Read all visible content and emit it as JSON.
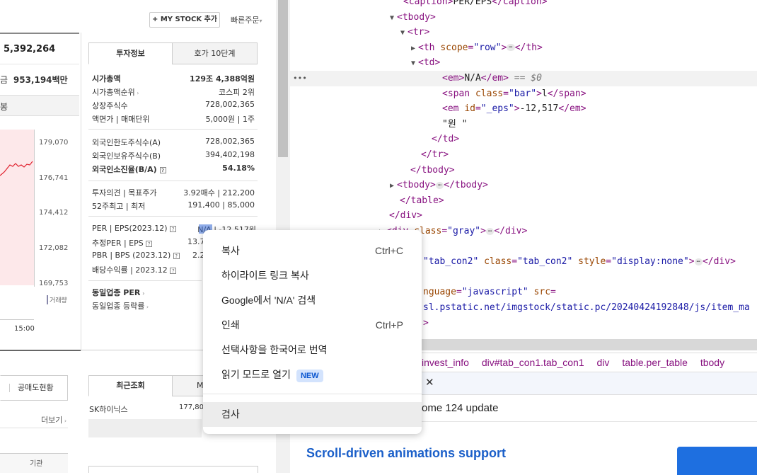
{
  "stock": {
    "mystock_button": "+ MY STOCK 추가",
    "quick_order": "빠른주문",
    "price_value": "5,392,264",
    "amount_label": "금",
    "amount_value": "953,194",
    "amount_unit": "백만",
    "chart_type_label": "봉",
    "y_labels": [
      "179,070",
      "176,741",
      "174,412",
      "172,082",
      "169,753"
    ],
    "time_label": "15:00",
    "volume_label": "거래량",
    "tabs": [
      "투자정보",
      "호가 10단계"
    ],
    "info_rows": [
      {
        "label": "시가총액",
        "value": "129조 4,388억원",
        "bold": true
      },
      {
        "label": "시가총액순위",
        "value": "코스피 2위"
      },
      {
        "label": "상장주식수",
        "value": "728,002,365"
      },
      {
        "label": "액면가 | 매매단위",
        "value": "5,000원 | 1주"
      },
      {
        "label": "외국인한도주식수(A)",
        "value": "728,002,365"
      },
      {
        "label": "외국인보유주식수(B)",
        "value": "394,402,198"
      },
      {
        "label": "외국인소진율(B/A)",
        "value": "54.18%",
        "bold": true
      },
      {
        "label": "투자의견 | 목표주가",
        "value": "3.92매수 | 212,200"
      },
      {
        "label": "52주최고 | 최저",
        "value": "191,400 | 85,000"
      },
      {
        "label": "PER | EPS(2023.12)",
        "value": "N/A | -12,517원"
      },
      {
        "label": "추정PER | EPS",
        "value": "13.7"
      },
      {
        "label": "PBR | BPS (2023.12)",
        "value": "2.2"
      },
      {
        "label": "배당수익률 | 2023.12",
        "value": ""
      },
      {
        "label": "동일업종 PER",
        "value": ""
      },
      {
        "label": "동일업종 등락률",
        "value": ""
      }
    ],
    "short_sell_label": "공매도현황",
    "more_label": "더보기",
    "institution_label": "기관",
    "recent_tabs": [
      "최근조회",
      "MY"
    ],
    "recent_item": "SK하이닉스",
    "recent_price": "177,800"
  },
  "devtools": {
    "lines": [
      {
        "indent": 160,
        "parts": [
          [
            "tag",
            "<caption>"
          ],
          [
            "txt",
            "PER/EPS"
          ],
          [
            "tag",
            "</caption>"
          ]
        ]
      },
      {
        "indent": 155,
        "arrow": "▼",
        "parts": [
          [
            "tag",
            "<tbody>"
          ]
        ]
      },
      {
        "indent": 170,
        "arrow": "▼",
        "parts": [
          [
            "tag",
            "<tr>"
          ]
        ]
      },
      {
        "indent": 185,
        "arrow": "▶",
        "parts": [
          [
            "tag",
            "<th "
          ],
          [
            "attr",
            "scope"
          ],
          [
            "tag",
            "="
          ],
          [
            "val",
            "\"row\""
          ],
          [
            "tag",
            ">"
          ],
          [
            "dots",
            "⋯"
          ],
          [
            "tag",
            "</th>"
          ]
        ]
      },
      {
        "indent": 185,
        "arrow": "▼",
        "parts": [
          [
            "tag",
            "<td>"
          ]
        ]
      },
      {
        "indent": 215,
        "hl": true,
        "parts": [
          [
            "tag",
            "<em>"
          ],
          [
            "txt",
            "N/A"
          ],
          [
            "tag",
            "</em>"
          ],
          [
            "cmt",
            " == $0"
          ]
        ]
      },
      {
        "indent": 215,
        "parts": [
          [
            "tag",
            "<span "
          ],
          [
            "attr",
            "class"
          ],
          [
            "tag",
            "="
          ],
          [
            "val",
            "\"bar\""
          ],
          [
            "tag",
            ">"
          ],
          [
            "txt",
            "l"
          ],
          [
            "tag",
            "</span>"
          ]
        ]
      },
      {
        "indent": 215,
        "parts": [
          [
            "tag",
            "<em "
          ],
          [
            "attr",
            "id"
          ],
          [
            "tag",
            "="
          ],
          [
            "val",
            "\"_eps\""
          ],
          [
            "tag",
            ">"
          ],
          [
            "txt",
            "-12,517"
          ],
          [
            "tag",
            "</em>"
          ]
        ]
      },
      {
        "indent": 215,
        "parts": [
          [
            "txt",
            "\"원 \""
          ]
        ]
      },
      {
        "indent": 200,
        "parts": [
          [
            "tag",
            "</td>"
          ]
        ]
      },
      {
        "indent": 185,
        "parts": [
          [
            "tag",
            "</tr>"
          ]
        ]
      },
      {
        "indent": 170,
        "parts": [
          [
            "tag",
            "</tbody>"
          ]
        ]
      },
      {
        "indent": 155,
        "arrow": "▶",
        "parts": [
          [
            "tag",
            "<tbody>"
          ],
          [
            "dots",
            "⋯"
          ],
          [
            "tag",
            "</tbody>"
          ]
        ]
      },
      {
        "indent": 155,
        "parts": [
          [
            "tag",
            "</table>"
          ]
        ]
      },
      {
        "indent": 140,
        "parts": [
          [
            "tag",
            "</div>"
          ]
        ]
      },
      {
        "indent": 140,
        "arrow": "▶",
        "parts": [
          [
            "tag",
            "<div "
          ],
          [
            "attr",
            "class"
          ],
          [
            "tag",
            "="
          ],
          [
            "val",
            "\"gray\""
          ],
          [
            "tag",
            ">"
          ],
          [
            "dots",
            "⋯"
          ],
          [
            "tag",
            "</div>"
          ]
        ]
      },
      {
        "indent": 0,
        "parts": []
      },
      {
        "indent": 188,
        "parts": [
          [
            "val",
            "\"tab_con2\" "
          ],
          [
            "attr",
            "class"
          ],
          [
            "tag",
            "="
          ],
          [
            "val",
            "\"tab_con2\" "
          ],
          [
            "attr",
            "style"
          ],
          [
            "tag",
            "="
          ],
          [
            "val",
            "\"display:none\""
          ],
          [
            "tag",
            ">"
          ],
          [
            "dots",
            "⋯"
          ],
          [
            "tag",
            "</div>"
          ]
        ]
      },
      {
        "indent": 0,
        "parts": []
      },
      {
        "indent": 188,
        "parts": [
          [
            "attr",
            "nguage"
          ],
          [
            "tag",
            "="
          ],
          [
            "val",
            "\"javascript\" "
          ],
          [
            "attr",
            "src"
          ],
          [
            "tag",
            "="
          ]
        ]
      },
      {
        "indent": 188,
        "parts": [
          [
            "val",
            "sl.pstatic.net/imgstock/static.pc/20240424192848/js/item_ma"
          ]
        ]
      },
      {
        "indent": 188,
        "parts": [
          [
            "tag",
            ">"
          ]
        ]
      }
    ],
    "breadcrumbs": [
      "invest_info",
      "div#tab_con1.tab_con1",
      "div",
      "table.per_table",
      "tbody"
    ],
    "drawer_text": "ome 124 update",
    "drawer_title": "Scroll-driven animations support"
  },
  "context_menu": {
    "items": [
      {
        "label": "복사",
        "shortcut": "Ctrl+C"
      },
      {
        "label": "하이라이트 링크 복사",
        "shortcut": ""
      },
      {
        "label": "Google에서 'N/A' 검색",
        "shortcut": ""
      },
      {
        "label": "인쇄",
        "shortcut": "Ctrl+P"
      },
      {
        "label": "선택사항을 한국어로 번역",
        "shortcut": ""
      },
      {
        "label": "읽기 모드로 열기",
        "shortcut": "",
        "badge": "NEW"
      },
      {
        "label": "검사",
        "shortcut": ""
      }
    ]
  }
}
